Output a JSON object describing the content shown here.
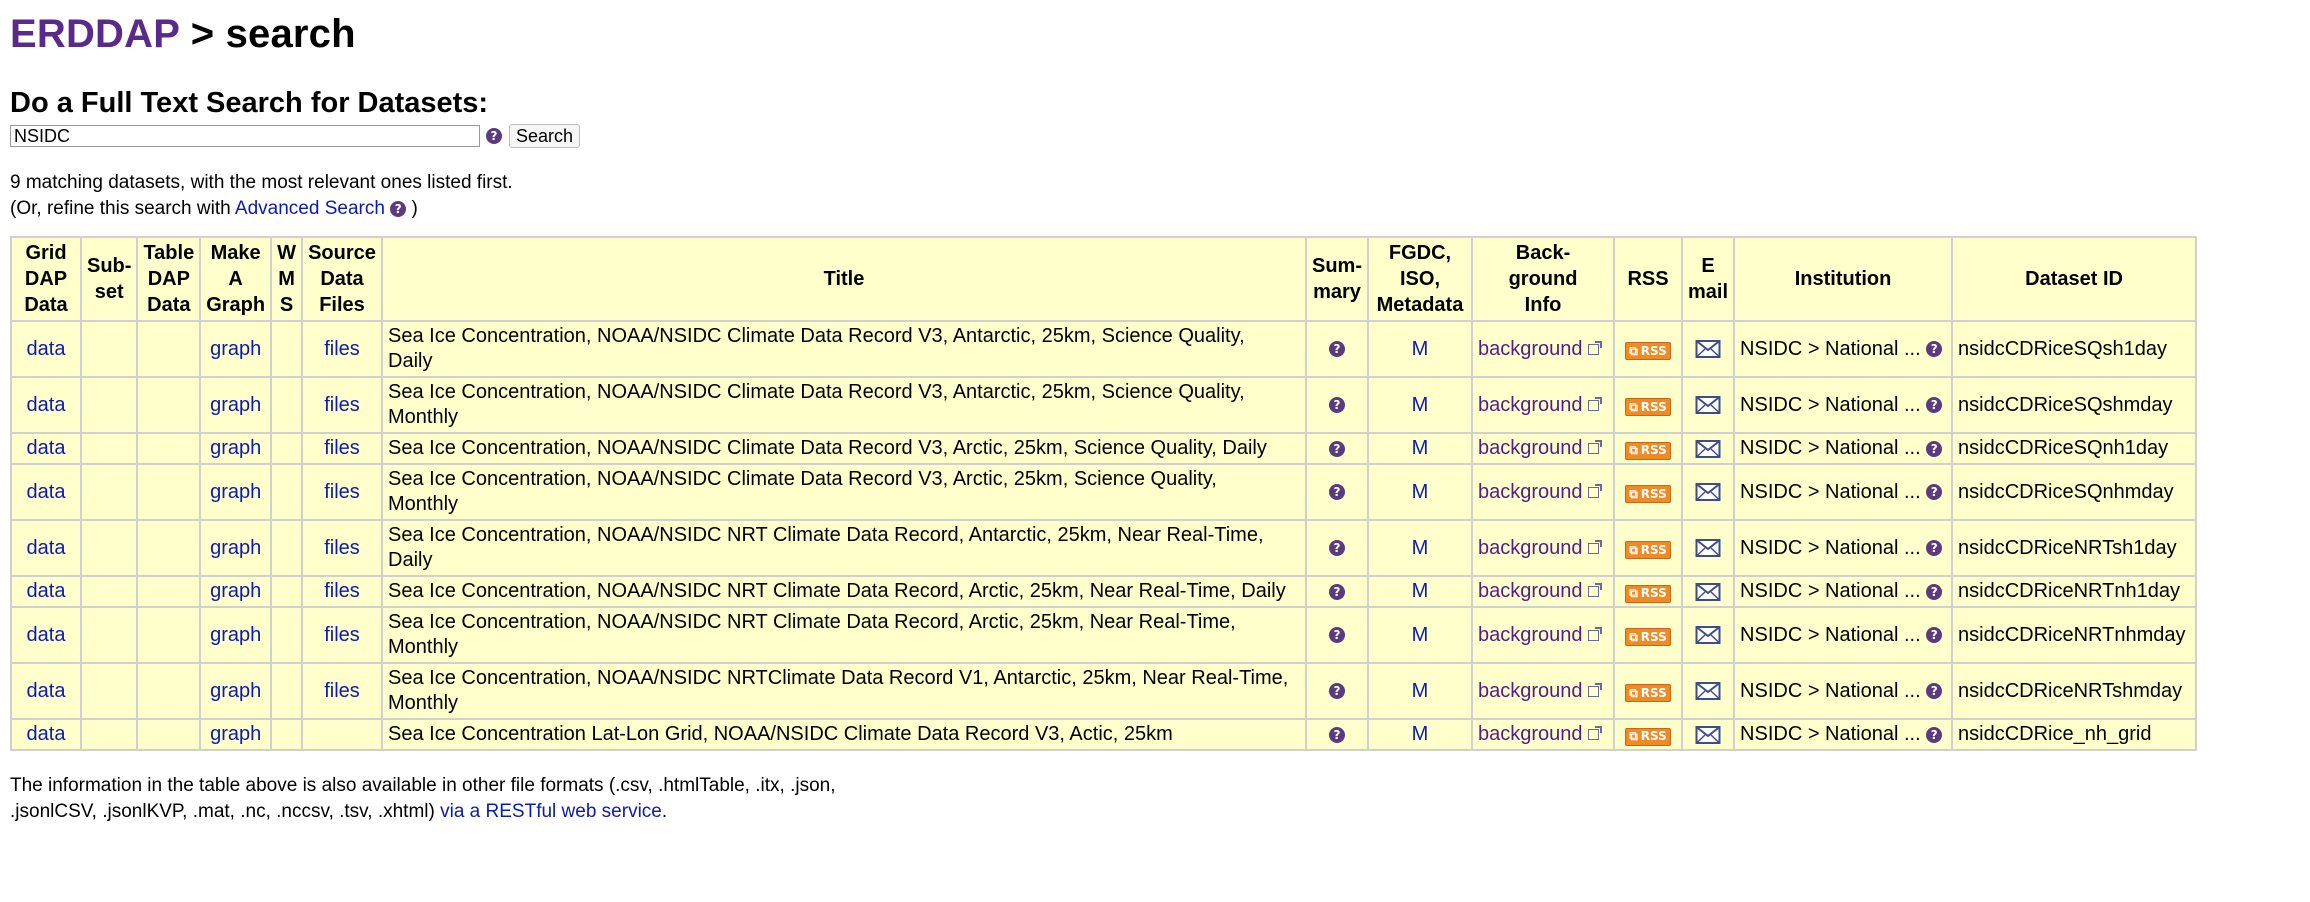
{
  "header": {
    "brand": "ERDDAP",
    "crumb": " > search"
  },
  "search": {
    "heading": "Do a Full Text Search for Datasets:",
    "value": "NSIDC",
    "button_label": "Search"
  },
  "results_info": {
    "count_text": "9 matching datasets, with the most relevant ones listed first.",
    "refine_prefix": "(Or, refine this search with ",
    "refine_link": "Advanced Search",
    "refine_suffix": " )"
  },
  "table": {
    "headers": {
      "griddap": [
        "Grid",
        "DAP",
        "Data"
      ],
      "subset": [
        "Sub-",
        "set"
      ],
      "tabledap": [
        "Table",
        "DAP",
        "Data"
      ],
      "makegraph": [
        "Make",
        "A",
        "Graph"
      ],
      "wms": [
        "W",
        "M",
        "S"
      ],
      "files": [
        "Source",
        "Data",
        "Files"
      ],
      "title": [
        "Title"
      ],
      "summary": [
        "Sum-",
        "mary"
      ],
      "metadata": [
        "FGDC,",
        "ISO,",
        "Metadata"
      ],
      "background": [
        "Back-",
        "ground",
        "Info"
      ],
      "rss": [
        "RSS"
      ],
      "email": [
        "E",
        "mail"
      ],
      "institution": [
        "Institution"
      ],
      "dataset_id": [
        "Dataset ID"
      ]
    },
    "rows": [
      {
        "griddap": "data",
        "graph": "graph",
        "files": "files",
        "title_line1": "Sea Ice Concentration, NOAA/NSIDC Climate Data Record V3, Antarctic, 25km, Science Quality,",
        "title_line2": "Daily",
        "metadata": "M",
        "background": "background",
        "rss": "RSS",
        "institution": "NSIDC > National ...",
        "dataset_id": "nsidcCDRiceSQsh1day"
      },
      {
        "griddap": "data",
        "graph": "graph",
        "files": "files",
        "title_line1": "Sea Ice Concentration, NOAA/NSIDC Climate Data Record V3, Antarctic, 25km, Science Quality,",
        "title_line2": "Monthly",
        "metadata": "M",
        "background": "background",
        "rss": "RSS",
        "institution": "NSIDC > National ...",
        "dataset_id": "nsidcCDRiceSQshmday"
      },
      {
        "griddap": "data",
        "graph": "graph",
        "files": "files",
        "title_line1": "Sea Ice Concentration, NOAA/NSIDC Climate Data Record V3, Arctic, 25km, Science Quality, Daily",
        "title_line2": "",
        "metadata": "M",
        "background": "background",
        "rss": "RSS",
        "institution": "NSIDC > National ...",
        "dataset_id": "nsidcCDRiceSQnh1day"
      },
      {
        "griddap": "data",
        "graph": "graph",
        "files": "files",
        "title_line1": "Sea Ice Concentration, NOAA/NSIDC Climate Data Record V3, Arctic, 25km, Science Quality,",
        "title_line2": "Monthly",
        "metadata": "M",
        "background": "background",
        "rss": "RSS",
        "institution": "NSIDC > National ...",
        "dataset_id": "nsidcCDRiceSQnhmday"
      },
      {
        "griddap": "data",
        "graph": "graph",
        "files": "files",
        "title_line1": "Sea Ice Concentration, NOAA/NSIDC NRT Climate Data Record, Antarctic, 25km, Near Real-Time,",
        "title_line2": "Daily",
        "metadata": "M",
        "background": "background",
        "rss": "RSS",
        "institution": "NSIDC > National ...",
        "dataset_id": "nsidcCDRiceNRTsh1day"
      },
      {
        "griddap": "data",
        "graph": "graph",
        "files": "files",
        "title_line1": "Sea Ice Concentration, NOAA/NSIDC NRT Climate Data Record, Arctic, 25km, Near Real-Time, Daily",
        "title_line2": "",
        "metadata": "M",
        "background": "background",
        "rss": "RSS",
        "institution": "NSIDC > National ...",
        "dataset_id": "nsidcCDRiceNRTnh1day"
      },
      {
        "griddap": "data",
        "graph": "graph",
        "files": "files",
        "title_line1": "Sea Ice Concentration, NOAA/NSIDC NRT Climate Data Record, Arctic, 25km, Near Real-Time,",
        "title_line2": "Monthly",
        "metadata": "M",
        "background": "background",
        "rss": "RSS",
        "institution": "NSIDC > National ...",
        "dataset_id": "nsidcCDRiceNRTnhmday"
      },
      {
        "griddap": "data",
        "graph": "graph",
        "files": "files",
        "title_line1": "Sea Ice Concentration, NOAA/NSIDC NRTClimate Data Record V1, Antarctic, 25km, Near Real-Time,",
        "title_line2": "Monthly",
        "metadata": "M",
        "background": "background",
        "rss": "RSS",
        "institution": "NSIDC > National ...",
        "dataset_id": "nsidcCDRiceNRTshmday"
      },
      {
        "griddap": "data",
        "graph": "graph",
        "files": "",
        "title_line1": "Sea Ice Concentration Lat-Lon Grid, NOAA/NSIDC Climate Data Record V3, Actic, 25km",
        "title_line2": "",
        "metadata": "M",
        "background": "background",
        "rss": "RSS",
        "institution": "NSIDC > National ...",
        "dataset_id": "nsidcCDRice_nh_grid"
      }
    ]
  },
  "footer": {
    "line1": "The information in the table above is also available in other file formats (.csv, .htmlTable, .itx, .json,",
    "line2_prefix": ".jsonlCSV, .jsonlKVP, .mat, .nc, .nccsv, .tsv, .xhtml) ",
    "line2_link": "via a RESTful web service",
    "line2_suffix": "."
  },
  "icons": {
    "help": "help-question-icon",
    "external": "external-link-icon",
    "rss": "rss-feed-icon",
    "email": "envelope-icon"
  },
  "colors": {
    "brand": "#5a2a8a",
    "link": "#0a19b8",
    "table_bg": "#ffffcc",
    "rss_orange": "#f08a24"
  }
}
